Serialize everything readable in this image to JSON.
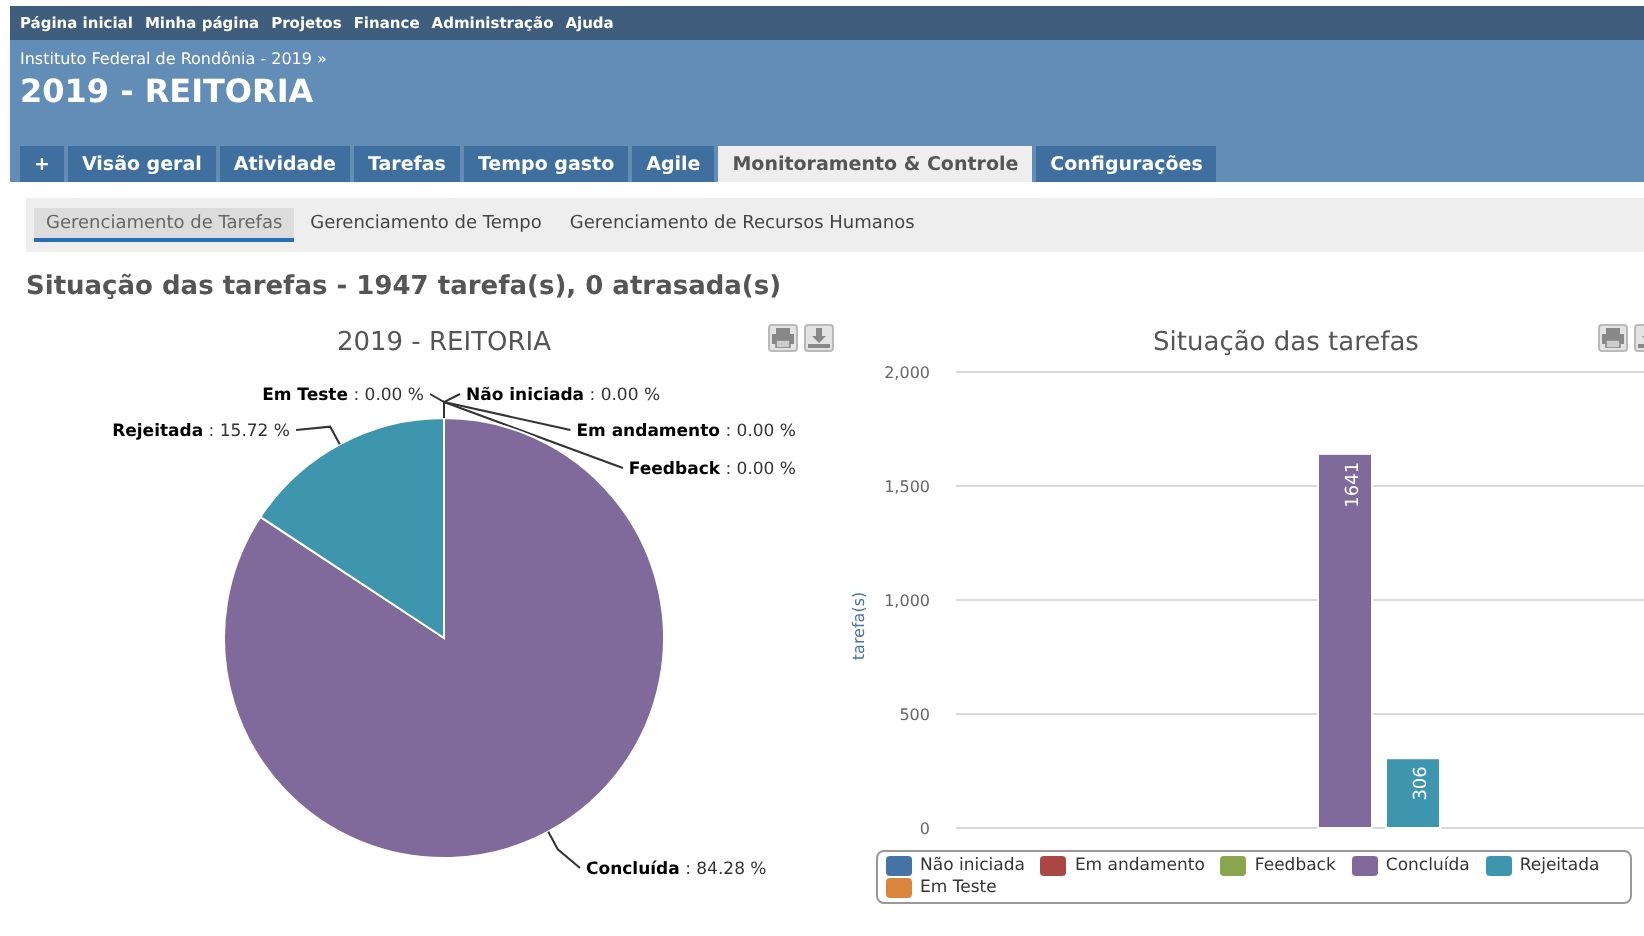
{
  "top_menu": [
    "Página inicial",
    "Minha página",
    "Projetos",
    "Finance",
    "Administração",
    "Ajuda"
  ],
  "header": {
    "breadcrumb": "Instituto Federal de Rondônia - 2019 »",
    "title": "2019 - REITORIA"
  },
  "tabs": [
    {
      "label": "+",
      "selected": false
    },
    {
      "label": "Visão geral",
      "selected": false
    },
    {
      "label": "Atividade",
      "selected": false
    },
    {
      "label": "Tarefas",
      "selected": false
    },
    {
      "label": "Tempo gasto",
      "selected": false
    },
    {
      "label": "Agile",
      "selected": false
    },
    {
      "label": "Monitoramento & Controle",
      "selected": true
    },
    {
      "label": "Configurações",
      "selected": false
    }
  ],
  "subtabs": [
    {
      "label": "Gerenciamento de Tarefas",
      "selected": true
    },
    {
      "label": "Gerenciamento de Tempo",
      "selected": false
    },
    {
      "label": "Gerenciamento de Recursos Humanos",
      "selected": false
    }
  ],
  "heading": "Situação das tarefas - 1947 tarefa(s), 0 atrasada(s)",
  "pie_panel": {
    "chart_data": {
      "type": "pie",
      "title": "2019 - REITORIA",
      "data_labels": true,
      "categories": [
        "Não iniciada",
        "Em andamento",
        "Feedback",
        "Concluída",
        "Rejeitada",
        "Em Teste"
      ],
      "values": [
        0,
        0,
        0,
        84.28,
        15.72,
        0
      ],
      "colors": [
        null,
        null,
        null,
        "#80699b",
        "#3d96ae",
        null
      ],
      "value_labels": [
        ": 0.00 %",
        ": 0.00 %",
        ": 0.00 %",
        ": 84.28 %",
        ": 15.72 %",
        ": 0.00 %"
      ]
    }
  },
  "bar_panel": {
    "chart_data": {
      "type": "bar",
      "title": "Situação das tarefas",
      "ylabel": "tarefa(s)",
      "ylim": [
        0,
        2000
      ],
      "yticks": [
        {
          "value": 0,
          "label": "0"
        },
        {
          "value": 500,
          "label": "500"
        },
        {
          "value": 1000,
          "label": "1,000"
        },
        {
          "value": 1500,
          "label": "1,500"
        },
        {
          "value": 2000,
          "label": "2,000"
        }
      ],
      "grid": true,
      "series": [
        {
          "name": "Não iniciada",
          "color": "#4572a7",
          "values": [
            0
          ],
          "value_labels": [
            null
          ]
        },
        {
          "name": "Em andamento",
          "color": "#aa4643",
          "values": [
            0
          ],
          "value_labels": [
            null
          ]
        },
        {
          "name": "Feedback",
          "color": "#89a54e",
          "values": [
            0
          ],
          "value_labels": [
            null
          ]
        },
        {
          "name": "Concluída",
          "color": "#80699b",
          "values": [
            1641
          ],
          "value_labels": [
            "1641"
          ]
        },
        {
          "name": "Rejeitada",
          "color": "#3d96ae",
          "values": [
            306
          ],
          "value_labels": [
            "306"
          ]
        },
        {
          "name": "Em Teste",
          "color": "#db843d",
          "values": [
            0
          ],
          "value_labels": [
            null
          ]
        }
      ]
    }
  }
}
